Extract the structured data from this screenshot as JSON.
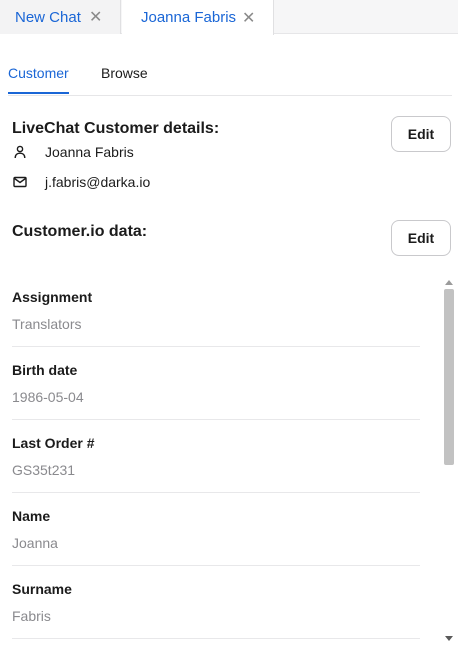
{
  "tabs": [
    {
      "label": "New Chat"
    },
    {
      "label": "Joanna Fabris"
    }
  ],
  "subtabs": {
    "customer": "Customer",
    "browse": "Browse"
  },
  "livechat": {
    "title": "LiveChat Customer details:",
    "edit_label": "Edit",
    "name": "Joanna Fabris",
    "email": "j.fabris@darka.io"
  },
  "customerio": {
    "title": "Customer.io data:",
    "edit_label": "Edit",
    "fields": [
      {
        "label": "Assignment",
        "value": "Translators"
      },
      {
        "label": "Birth date",
        "value": "1986-05-04"
      },
      {
        "label": "Last Order #",
        "value": "GS35t231"
      },
      {
        "label": "Name",
        "value": "Joanna"
      },
      {
        "label": "Surname",
        "value": "Fabris"
      }
    ]
  },
  "colors": {
    "accent": "#1a66d6",
    "muted_text": "#8a8a8e"
  },
  "icons": {
    "close": "close-icon",
    "person": "person-icon",
    "mail": "mail-icon"
  }
}
